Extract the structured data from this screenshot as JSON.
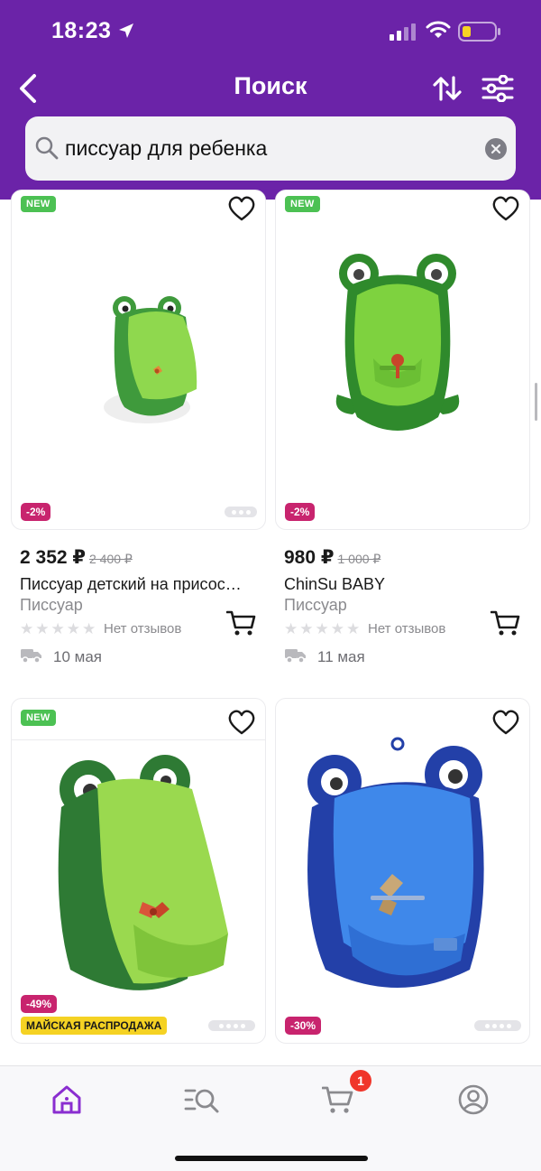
{
  "status_bar": {
    "time": "18:23"
  },
  "header": {
    "title": "Поиск"
  },
  "search": {
    "value": "писсуар для ребенка"
  },
  "labels": {
    "new": "NEW"
  },
  "products": [
    {
      "discount": "-2%",
      "price": "2 352 ₽",
      "old_price": "2 400 ₽",
      "name": "Писсуар детский на присос…",
      "category": "Писсуар",
      "reviews": "Нет отзывов",
      "delivery": "10 мая",
      "color_main": "#3f9a3c",
      "color_inner": "#8fd84e"
    },
    {
      "discount": "-2%",
      "price": "980 ₽",
      "old_price": "1 000 ₽",
      "name": "ChinSu BABY",
      "category": "Писсуар",
      "reviews": "Нет отзывов",
      "delivery": "11 мая",
      "color_main": "#2f8a2c",
      "color_inner": "#7ed23f"
    },
    {
      "discount": "-49%",
      "sale": "МАЙСКАЯ РАСПРОДАЖА",
      "color_main": "#2e7a34",
      "color_inner": "#9ad94f"
    },
    {
      "discount": "-30%",
      "color_main": "#2340a8",
      "color_inner": "#3f88ea"
    }
  ],
  "cart": {
    "count": "1"
  },
  "icons": [
    "back-icon",
    "sort-icon",
    "filter-icon",
    "search-icon",
    "clear-icon",
    "heart-icon",
    "cart-icon",
    "truck-icon",
    "home-icon",
    "catalog-search-icon",
    "profile-icon"
  ],
  "colors": {
    "brand": "#6b23a8",
    "new_badge": "#4cc153",
    "discount": "#c8246e",
    "sale": "#f5d223",
    "cart_badge": "#f0352a"
  }
}
